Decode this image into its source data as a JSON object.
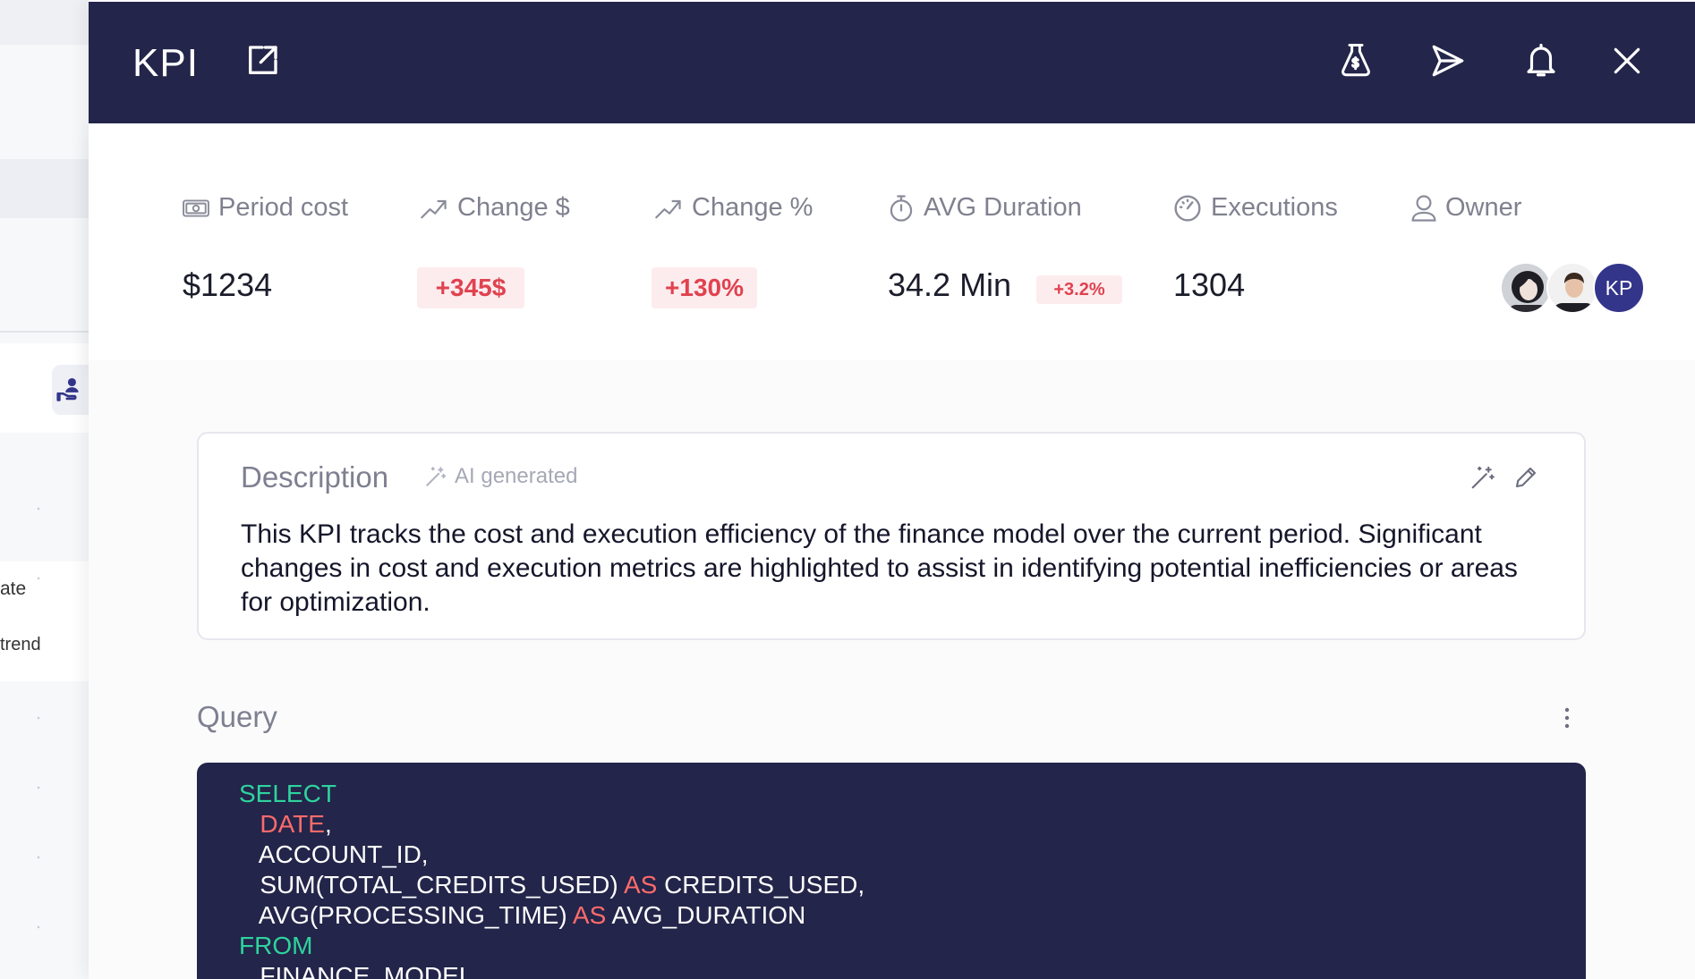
{
  "background": {
    "text_1": "ate",
    "text_2": "trend"
  },
  "header": {
    "title": "KPI",
    "icons": [
      "external-link-icon",
      "cost-bag-icon",
      "send-icon",
      "bell-icon",
      "close-icon"
    ]
  },
  "metrics": [
    {
      "label": "Period cost",
      "value": "$1234",
      "icon": "money-icon"
    },
    {
      "label": "Change $",
      "value": "+345$",
      "icon": "trend-up-icon"
    },
    {
      "label": "Change %",
      "value": "+130%",
      "icon": "trend-up-icon"
    },
    {
      "label": "AVG Duration",
      "value": "34.2 Min",
      "badge": "+3.2%",
      "icon": "stopwatch-icon"
    },
    {
      "label": "Executions",
      "value": "1304",
      "icon": "gauge-icon"
    },
    {
      "label": "Owner",
      "icon": "user-icon",
      "avatars": [
        "avatar-woman",
        "avatar-man",
        "KP"
      ]
    }
  ],
  "description": {
    "title": "Description",
    "ai_label": "AI generated",
    "text": "This KPI tracks the cost and execution efficiency of the finance model over the current period. Significant changes in cost and execution metrics are highlighted to assist in identifying potential inefficiencies or areas for optimization."
  },
  "query": {
    "title": "Query",
    "lines": [
      {
        "indent": "",
        "parts": [
          {
            "t": "SELECT",
            "c": "kw"
          }
        ]
      },
      {
        "indent": "   ",
        "parts": [
          {
            "t": "DATE",
            "c": "op"
          },
          {
            "t": ",",
            "c": ""
          }
        ]
      },
      {
        "indent": "   ",
        "parts": [
          {
            "t": "ACCOUNT_ID,",
            "c": ""
          }
        ]
      },
      {
        "indent": "   ",
        "parts": [
          {
            "t": "SUM(TOTAL_CREDITS_USED) ",
            "c": ""
          },
          {
            "t": "AS",
            "c": "op"
          },
          {
            "t": " CREDITS_USED,",
            "c": ""
          }
        ]
      },
      {
        "indent": "   ",
        "parts": [
          {
            "t": "AVG(PROCESSING_TIME) ",
            "c": ""
          },
          {
            "t": "AS",
            "c": "op"
          },
          {
            "t": " AVG_DURATION",
            "c": ""
          }
        ]
      },
      {
        "indent": "",
        "parts": [
          {
            "t": "FROM",
            "c": "kw"
          }
        ]
      },
      {
        "indent": "   ",
        "parts": [
          {
            "t": "FINANCE_MODEL",
            "c": ""
          }
        ]
      }
    ]
  },
  "colors": {
    "header_bg": "#23254a",
    "badge_bg": "#fdecee",
    "badge_text": "#e0424f",
    "sql_keyword": "#2ed39d",
    "sql_operator": "#ff6b6b"
  }
}
